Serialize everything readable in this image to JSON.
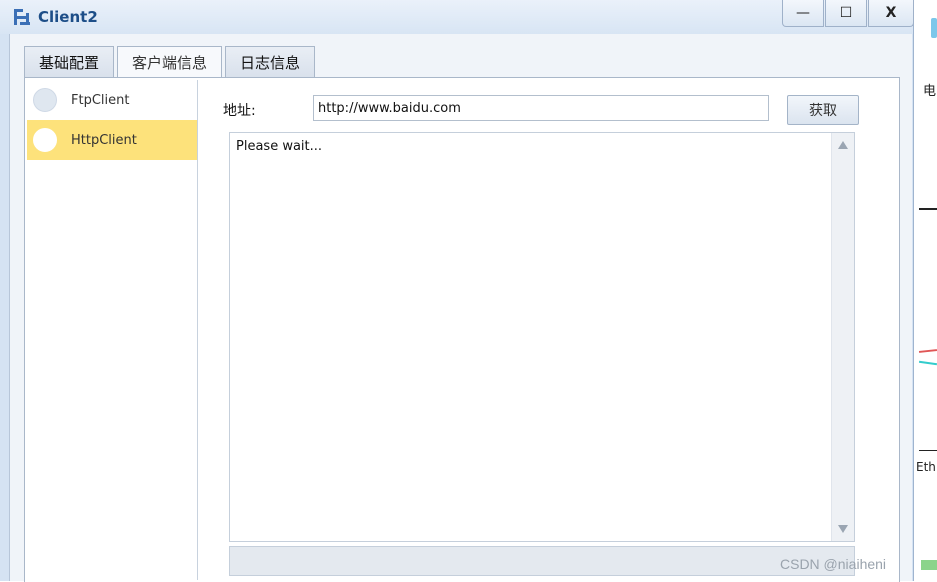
{
  "window": {
    "title": "Client2",
    "minimize_glyph": "—",
    "maximize_glyph": "☐",
    "close_glyph": "X"
  },
  "tabs": [
    {
      "label": "基础配置"
    },
    {
      "label": "客户端信息",
      "active": true
    },
    {
      "label": "日志信息"
    }
  ],
  "clients": [
    {
      "label": "FtpClient",
      "selected": false
    },
    {
      "label": "HttpClient",
      "selected": true
    }
  ],
  "form": {
    "address_label": "地址:",
    "address_value": "http://www.baidu.com",
    "fetch_label": "获取"
  },
  "output": {
    "text": "Please wait..."
  },
  "background": {
    "partial_char": "电",
    "partial_text": "Eth"
  },
  "watermark": "CSDN @niaiheni",
  "colors": {
    "selected_item": "#fde27b",
    "title_text": "#1d4e88"
  }
}
